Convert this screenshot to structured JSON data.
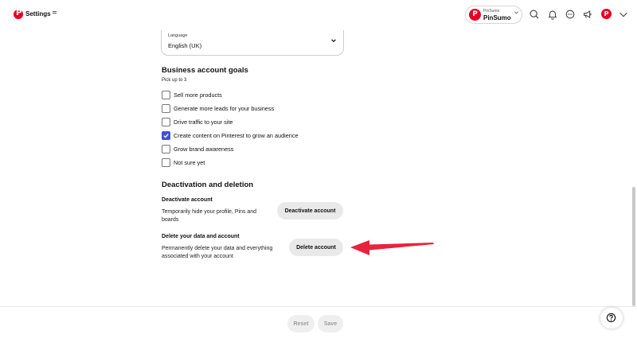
{
  "header": {
    "title": "Settings",
    "account": {
      "small_label": "PinSumo",
      "name": "PinSumo"
    }
  },
  "language": {
    "label": "Language",
    "value": "English (UK)"
  },
  "goals": {
    "title": "Business account goals",
    "hint": "Pick up to 3",
    "items": [
      {
        "label": "Sell more products",
        "checked": false
      },
      {
        "label": "Generate more leads for your business",
        "checked": false
      },
      {
        "label": "Drive traffic to your site",
        "checked": false
      },
      {
        "label": "Create content on Pinterest to grow an audience",
        "checked": true
      },
      {
        "label": "Grow brand awareness",
        "checked": false
      },
      {
        "label": "Not sure yet",
        "checked": false
      }
    ]
  },
  "deactivation": {
    "title": "Deactivation and deletion",
    "deactivate": {
      "title": "Deactivate account",
      "description": "Temporarily hide your profile, Pins and boards",
      "button": "Deactivate account"
    },
    "delete": {
      "title": "Delete your data and account",
      "description": "Permanently delete your data and everything associated with your account",
      "button": "Delete account"
    }
  },
  "footer": {
    "reset_label": "Reset",
    "save_label": "Save"
  },
  "colors": {
    "brand": "#e60023",
    "checkbox": "#3f51d4",
    "arrow": "#e8233f"
  },
  "icons": [
    "pinterest-logo-icon",
    "menu-icon",
    "chevron-down-icon",
    "search-icon",
    "bell-icon",
    "messages-icon",
    "megaphone-icon",
    "help-icon"
  ]
}
